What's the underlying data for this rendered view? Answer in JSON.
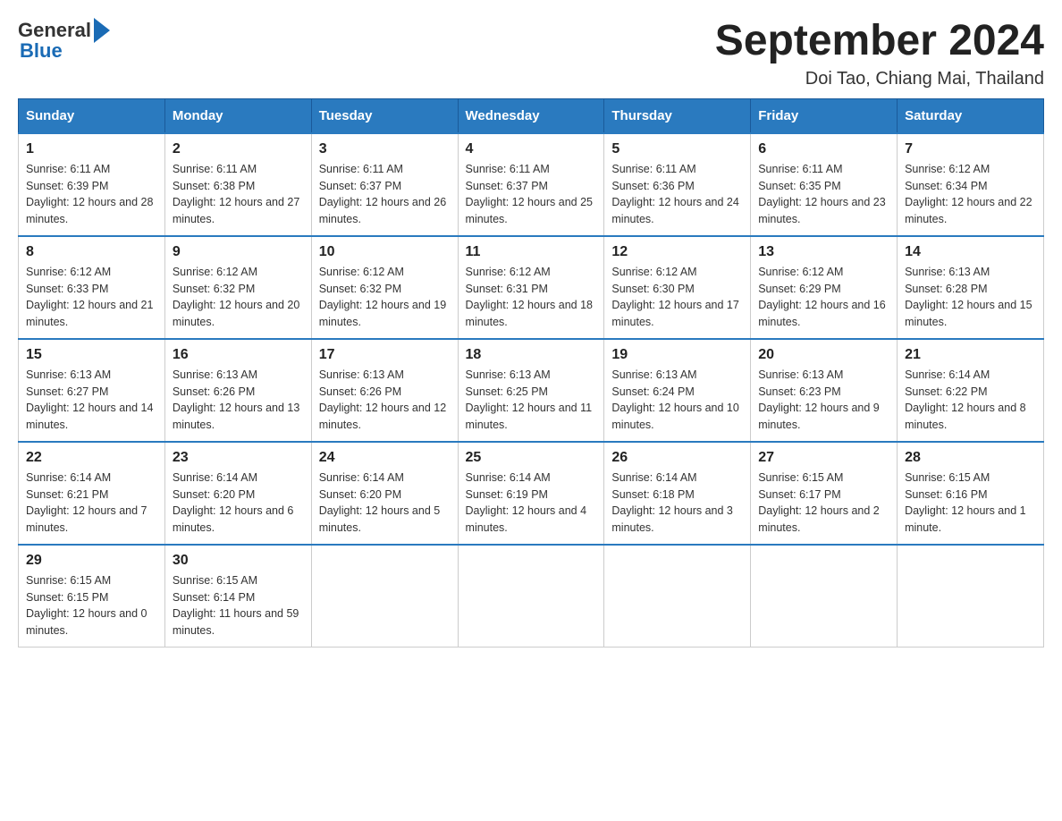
{
  "header": {
    "month_title": "September 2024",
    "location": "Doi Tao, Chiang Mai, Thailand",
    "logo_general": "General",
    "logo_blue": "Blue"
  },
  "days_of_week": [
    "Sunday",
    "Monday",
    "Tuesday",
    "Wednesday",
    "Thursday",
    "Friday",
    "Saturday"
  ],
  "weeks": [
    [
      {
        "day": "1",
        "sunrise": "6:11 AM",
        "sunset": "6:39 PM",
        "daylight": "12 hours and 28 minutes."
      },
      {
        "day": "2",
        "sunrise": "6:11 AM",
        "sunset": "6:38 PM",
        "daylight": "12 hours and 27 minutes."
      },
      {
        "day": "3",
        "sunrise": "6:11 AM",
        "sunset": "6:37 PM",
        "daylight": "12 hours and 26 minutes."
      },
      {
        "day": "4",
        "sunrise": "6:11 AM",
        "sunset": "6:37 PM",
        "daylight": "12 hours and 25 minutes."
      },
      {
        "day": "5",
        "sunrise": "6:11 AM",
        "sunset": "6:36 PM",
        "daylight": "12 hours and 24 minutes."
      },
      {
        "day": "6",
        "sunrise": "6:11 AM",
        "sunset": "6:35 PM",
        "daylight": "12 hours and 23 minutes."
      },
      {
        "day": "7",
        "sunrise": "6:12 AM",
        "sunset": "6:34 PM",
        "daylight": "12 hours and 22 minutes."
      }
    ],
    [
      {
        "day": "8",
        "sunrise": "6:12 AM",
        "sunset": "6:33 PM",
        "daylight": "12 hours and 21 minutes."
      },
      {
        "day": "9",
        "sunrise": "6:12 AM",
        "sunset": "6:32 PM",
        "daylight": "12 hours and 20 minutes."
      },
      {
        "day": "10",
        "sunrise": "6:12 AM",
        "sunset": "6:32 PM",
        "daylight": "12 hours and 19 minutes."
      },
      {
        "day": "11",
        "sunrise": "6:12 AM",
        "sunset": "6:31 PM",
        "daylight": "12 hours and 18 minutes."
      },
      {
        "day": "12",
        "sunrise": "6:12 AM",
        "sunset": "6:30 PM",
        "daylight": "12 hours and 17 minutes."
      },
      {
        "day": "13",
        "sunrise": "6:12 AM",
        "sunset": "6:29 PM",
        "daylight": "12 hours and 16 minutes."
      },
      {
        "day": "14",
        "sunrise": "6:13 AM",
        "sunset": "6:28 PM",
        "daylight": "12 hours and 15 minutes."
      }
    ],
    [
      {
        "day": "15",
        "sunrise": "6:13 AM",
        "sunset": "6:27 PM",
        "daylight": "12 hours and 14 minutes."
      },
      {
        "day": "16",
        "sunrise": "6:13 AM",
        "sunset": "6:26 PM",
        "daylight": "12 hours and 13 minutes."
      },
      {
        "day": "17",
        "sunrise": "6:13 AM",
        "sunset": "6:26 PM",
        "daylight": "12 hours and 12 minutes."
      },
      {
        "day": "18",
        "sunrise": "6:13 AM",
        "sunset": "6:25 PM",
        "daylight": "12 hours and 11 minutes."
      },
      {
        "day": "19",
        "sunrise": "6:13 AM",
        "sunset": "6:24 PM",
        "daylight": "12 hours and 10 minutes."
      },
      {
        "day": "20",
        "sunrise": "6:13 AM",
        "sunset": "6:23 PM",
        "daylight": "12 hours and 9 minutes."
      },
      {
        "day": "21",
        "sunrise": "6:14 AM",
        "sunset": "6:22 PM",
        "daylight": "12 hours and 8 minutes."
      }
    ],
    [
      {
        "day": "22",
        "sunrise": "6:14 AM",
        "sunset": "6:21 PM",
        "daylight": "12 hours and 7 minutes."
      },
      {
        "day": "23",
        "sunrise": "6:14 AM",
        "sunset": "6:20 PM",
        "daylight": "12 hours and 6 minutes."
      },
      {
        "day": "24",
        "sunrise": "6:14 AM",
        "sunset": "6:20 PM",
        "daylight": "12 hours and 5 minutes."
      },
      {
        "day": "25",
        "sunrise": "6:14 AM",
        "sunset": "6:19 PM",
        "daylight": "12 hours and 4 minutes."
      },
      {
        "day": "26",
        "sunrise": "6:14 AM",
        "sunset": "6:18 PM",
        "daylight": "12 hours and 3 minutes."
      },
      {
        "day": "27",
        "sunrise": "6:15 AM",
        "sunset": "6:17 PM",
        "daylight": "12 hours and 2 minutes."
      },
      {
        "day": "28",
        "sunrise": "6:15 AM",
        "sunset": "6:16 PM",
        "daylight": "12 hours and 1 minute."
      }
    ],
    [
      {
        "day": "29",
        "sunrise": "6:15 AM",
        "sunset": "6:15 PM",
        "daylight": "12 hours and 0 minutes."
      },
      {
        "day": "30",
        "sunrise": "6:15 AM",
        "sunset": "6:14 PM",
        "daylight": "11 hours and 59 minutes."
      },
      null,
      null,
      null,
      null,
      null
    ]
  ],
  "labels": {
    "sunrise_prefix": "Sunrise: ",
    "sunset_prefix": "Sunset: ",
    "daylight_prefix": "Daylight: "
  }
}
